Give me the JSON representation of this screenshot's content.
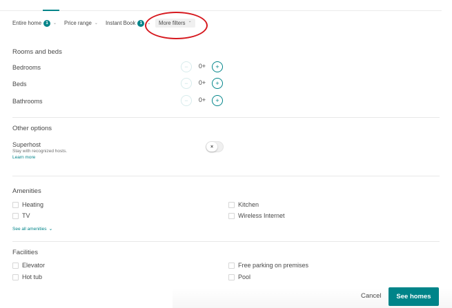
{
  "colors": {
    "accent": "#008489",
    "annotation": "#d6181e",
    "text": "#484848",
    "divider": "#e8e8e8"
  },
  "filter_bar": {
    "entire_home": {
      "label": "Entire home",
      "badge": "1"
    },
    "price_range": {
      "label": "Price range"
    },
    "instant_book": {
      "label": "Instant Book",
      "badge": "1"
    },
    "more_filters": {
      "label": "More filters",
      "expanded": true
    }
  },
  "rooms_and_beds": {
    "title": "Rooms and beds",
    "rows": [
      {
        "label": "Bedrooms",
        "value": "0+",
        "minus_icon": "minus",
        "plus_icon": "plus"
      },
      {
        "label": "Beds",
        "value": "0+",
        "minus_icon": "minus",
        "plus_icon": "plus"
      },
      {
        "label": "Bathrooms",
        "value": "0+",
        "minus_icon": "minus",
        "plus_icon": "plus"
      }
    ]
  },
  "other_options": {
    "title": "Other options",
    "superhost": {
      "label": "Superhost",
      "description": "Stay with recognized hosts.",
      "learn_more": "Learn more",
      "toggle_on": false,
      "toggle_icon": "×"
    }
  },
  "amenities": {
    "title": "Amenities",
    "left": [
      {
        "label": "Heating",
        "checked": false
      },
      {
        "label": "TV",
        "checked": false
      }
    ],
    "right": [
      {
        "label": "Kitchen",
        "checked": false
      },
      {
        "label": "Wireless Internet",
        "checked": false
      }
    ],
    "see_all": "See all amenities"
  },
  "facilities": {
    "title": "Facilities",
    "left": [
      {
        "label": "Elevator",
        "checked": false
      },
      {
        "label": "Hot tub",
        "checked": false
      }
    ],
    "right": [
      {
        "label": "Free parking on premises",
        "checked": false
      },
      {
        "label": "Pool",
        "checked": false
      }
    ]
  },
  "footer": {
    "cancel": "Cancel",
    "see_homes": "See homes"
  }
}
